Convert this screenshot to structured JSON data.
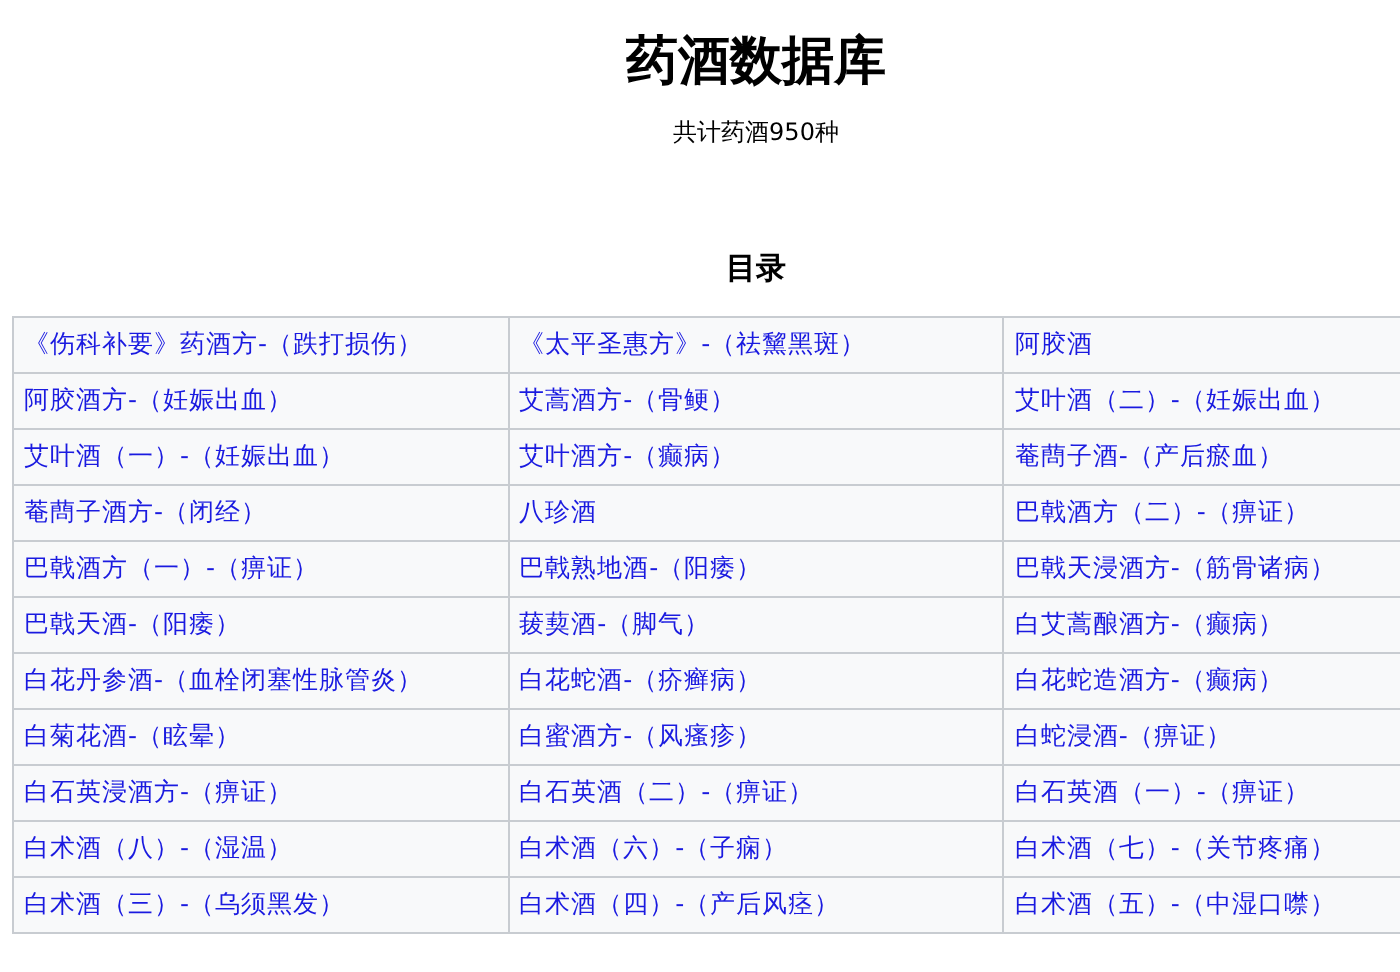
{
  "title": "药酒数据库",
  "subtitle": "共计药酒950种",
  "toc": {
    "heading": "目录",
    "rows": [
      [
        "《伤科补要》药酒方-（跌打损伤）",
        "《太平圣惠方》-（祛黧黑斑）",
        "阿胶酒"
      ],
      [
        "阿胶酒方-（妊娠出血）",
        "艾蒿酒方-（骨鲠）",
        "艾叶酒（二）-（妊娠出血）"
      ],
      [
        "艾叶酒（一）-（妊娠出血）",
        "艾叶酒方-（癫病）",
        "菴蔄子酒-（产后瘀血）"
      ],
      [
        "菴蔄子酒方-（闭经）",
        "八珍酒",
        "巴戟酒方（二）-（痹证）"
      ],
      [
        "巴戟酒方（一）-（痹证）",
        "巴戟熟地酒-（阳痿）",
        "巴戟天浸酒方-（筋骨诸病）"
      ],
      [
        "巴戟天酒-（阳痿）",
        "菝葜酒-（脚气）",
        "白艾蒿酿酒方-（癫病）"
      ],
      [
        "白花丹参酒-（血栓闭塞性脉管炎）",
        "白花蛇酒-（疥癣病）",
        "白花蛇造酒方-（癫病）"
      ],
      [
        "白菊花酒-（眩晕）",
        "白蜜酒方-（风瘙疹）",
        "白蛇浸酒-（痹证）"
      ],
      [
        "白石英浸酒方-（痹证）",
        "白石英酒（二）-（痹证）",
        "白石英酒（一）-（痹证）"
      ],
      [
        "白术酒（八）-（湿温）",
        "白术酒（六）-（子痫）",
        "白术酒（七）-（关节疼痛）"
      ],
      [
        "白术酒（三）-（乌须黑发）",
        "白术酒（四）-（产后风痉）",
        "白术酒（五）-（中湿口噤）"
      ]
    ]
  }
}
